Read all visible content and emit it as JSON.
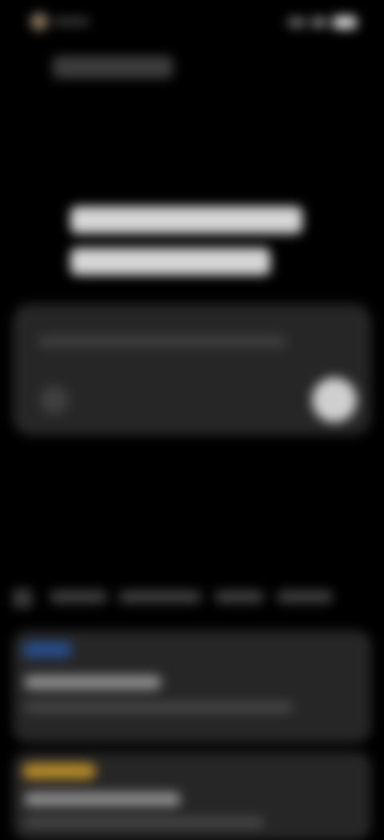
{
  "status_bar": {
    "time": "",
    "icons": [
      "avatar-icon",
      "signal-icon",
      "wifi-icon",
      "battery-icon"
    ]
  },
  "header": {
    "title": ""
  },
  "hero": {
    "heading_line_1": "",
    "heading_line_2": ""
  },
  "prompt": {
    "placeholder": "",
    "icons": [
      "attach-icon",
      "send-icon"
    ]
  },
  "filters": {
    "items": [
      "",
      "",
      "",
      ""
    ]
  },
  "cards": [
    {
      "tag": "",
      "title": "",
      "description": ""
    },
    {
      "tag": "",
      "title": "",
      "description": ""
    }
  ],
  "colors": {
    "background": "#000000",
    "surface": "#262626",
    "tag_blue": "#274d8a",
    "tag_amber": "#b58a2a",
    "text_primary": "#d6d6d6"
  }
}
